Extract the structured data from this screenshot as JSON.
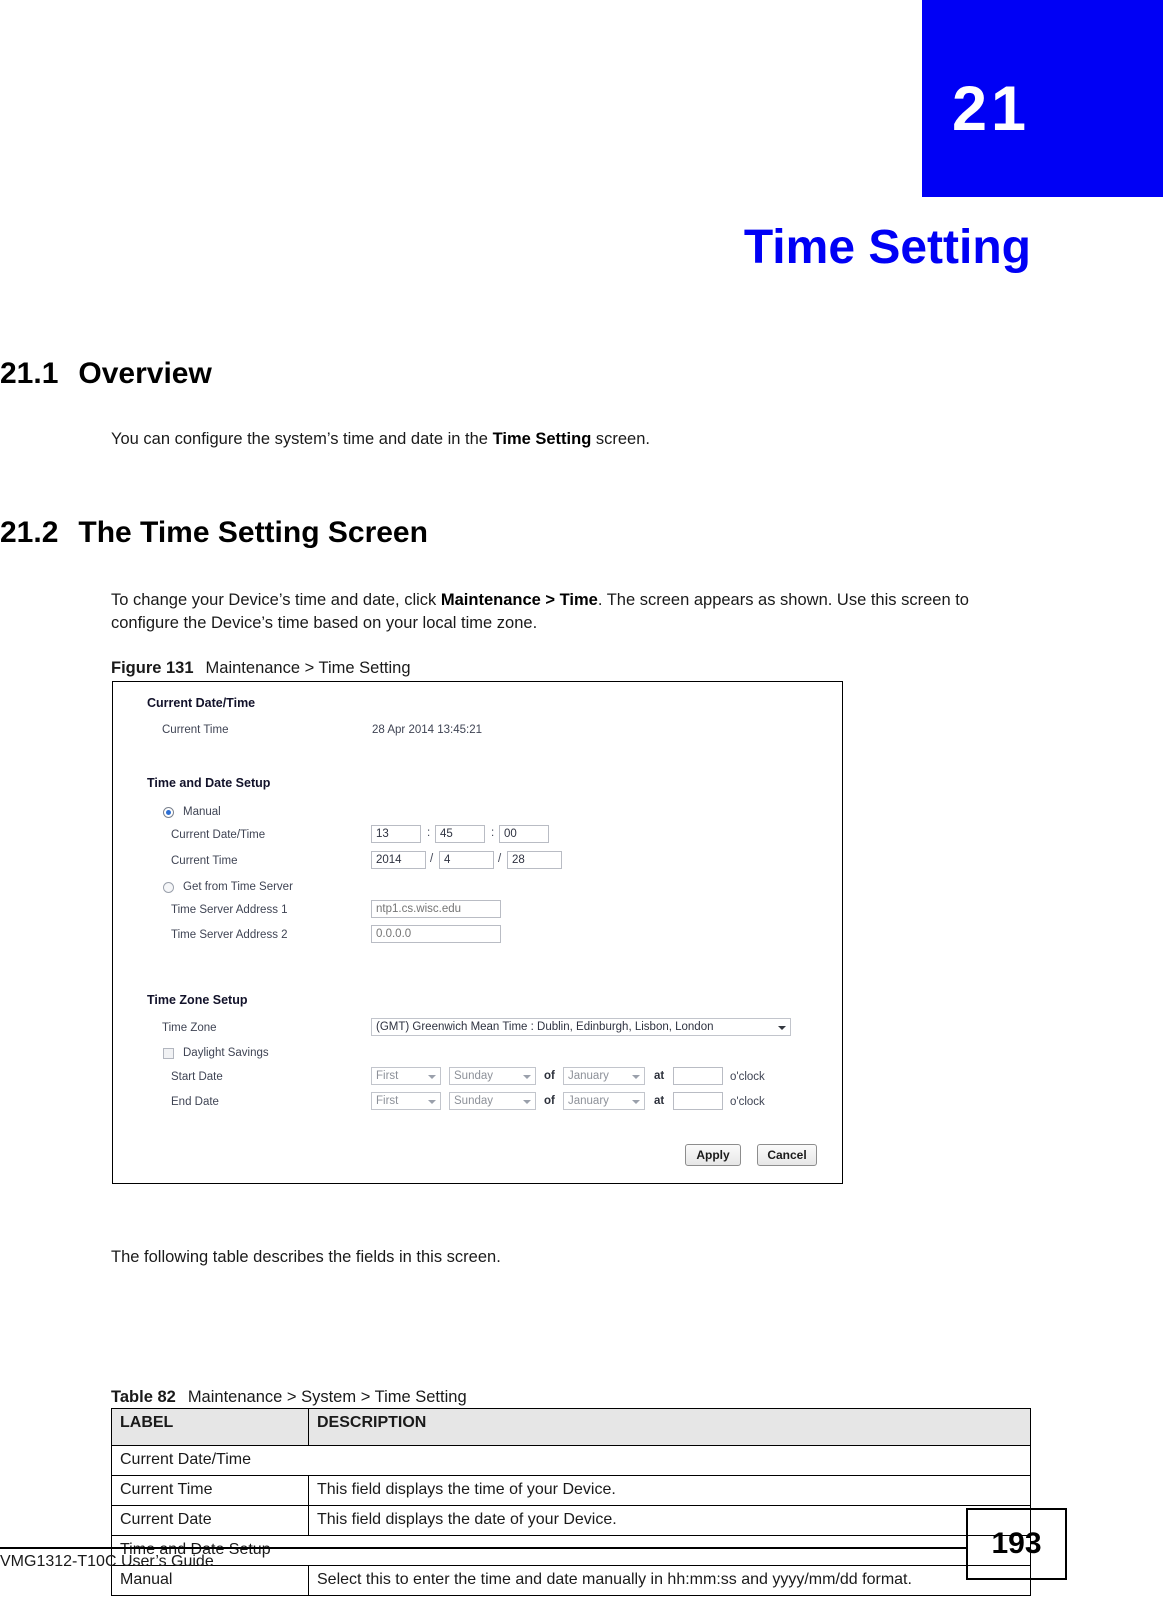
{
  "chapter": {
    "number": "21",
    "title": "Time Setting"
  },
  "sections": {
    "overview": {
      "number": "21.1",
      "heading": "Overview",
      "para_pre": "You can configure the system’s time and date in the ",
      "para_bold": "Time Setting",
      "para_post": " screen."
    },
    "screen": {
      "number": "21.2",
      "heading": "The Time Setting Screen",
      "para_pre": "To change your Device’s time and date, click ",
      "para_bold": "Maintenance > Time",
      "para_post": ". The screen appears as shown. Use this screen to configure the Device’s time based on your local time zone."
    }
  },
  "figure": {
    "label": "Figure 131",
    "caption": "Maintenance > Time Setting",
    "ui": {
      "current_datetime_title": "Current Date/Time",
      "current_time_label": "Current Time",
      "current_time_value": "28 Apr 2014 13:45:21",
      "time_date_setup_title": "Time and Date Setup",
      "manual_label": "Manual",
      "manual_selected": true,
      "manual_datetime_label": "Current Date/Time",
      "manual_hour": "13",
      "manual_minute": "45",
      "manual_second": "00",
      "sep_colon": ":",
      "manual_date_label": "Current Time",
      "manual_year": "2014",
      "manual_month": "4",
      "manual_day": "28",
      "sep_slash": "/",
      "time_server_label": "Get from Time Server",
      "time_server_selected": false,
      "server1_label": "Time Server Address 1",
      "server1_placeholder": "ntp1.cs.wisc.edu",
      "server2_label": "Time Server Address 2",
      "server2_placeholder": "0.0.0.0",
      "time_zone_setup_title": "Time Zone Setup",
      "time_zone_label": "Time Zone",
      "time_zone_value": "(GMT) Greenwich Mean Time : Dublin, Edinburgh, Lisbon, London",
      "daylight_savings_label": "Daylight Savings",
      "daylight_savings_checked": false,
      "start_date_label": "Start Date",
      "end_date_label": "End Date",
      "ordinal_value": "First",
      "weekday_value": "Sunday",
      "month_value": "January",
      "of_label": "of",
      "at_label": "at",
      "oclock_label": "o'clock",
      "start_hour": "",
      "end_hour": "",
      "apply_label": "Apply",
      "cancel_label": "Cancel"
    }
  },
  "table_intro": "The following table describes the fields in this screen.",
  "table": {
    "label": "Table 82",
    "caption": "Maintenance > System > Time Setting",
    "headers": [
      "LABEL",
      "DESCRIPTION"
    ],
    "rows": [
      {
        "type": "group",
        "label": "Current Date/Time",
        "description": ""
      },
      {
        "type": "item",
        "label": "Current Time",
        "description": "This field displays the time of your Device."
      },
      {
        "type": "item",
        "label": "Current Date",
        "description": "This field displays the date of your Device."
      },
      {
        "type": "group",
        "label": "Time and Date Setup",
        "description": ""
      },
      {
        "type": "item",
        "label": "Manual",
        "description": "Select this to enter the time and date manually in hh:mm:ss and yyyy/mm/dd format."
      }
    ]
  },
  "footer": {
    "guide": "VMG1312-T10C User’s Guide",
    "page": "193"
  },
  "colors": {
    "chapter_blue": "#0000f5",
    "table_header_gray": "#e6e6e6"
  }
}
